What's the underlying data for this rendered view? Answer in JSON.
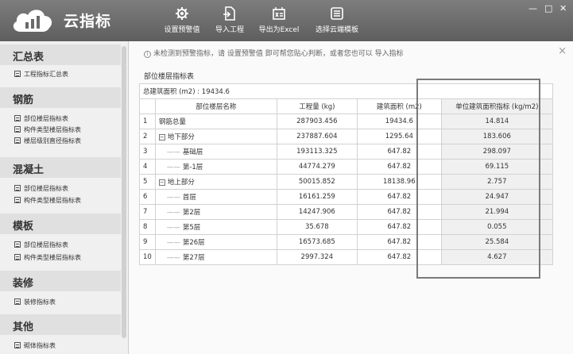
{
  "app": {
    "title": "云指标"
  },
  "toolbar": [
    {
      "label": "设置预警值",
      "icon": "gear-icon"
    },
    {
      "label": "导入工程",
      "icon": "import-icon"
    },
    {
      "label": "导出为Excel",
      "icon": "excel-icon"
    },
    {
      "label": "选择云端模板",
      "icon": "template-icon"
    }
  ],
  "sidebar": {
    "sections": [
      {
        "title": "汇总表",
        "items": [
          "工程指标汇总表"
        ]
      },
      {
        "title": "钢筋",
        "items": [
          "部位楼层指标表",
          "构件类型楼层指标表",
          "楼层级别直径指标表"
        ]
      },
      {
        "title": "混凝土",
        "items": [
          "部位楼层指标表",
          "构件类型楼层指标表"
        ]
      },
      {
        "title": "模板",
        "items": [
          "部位楼层指标表",
          "构件类型楼层指标表"
        ]
      },
      {
        "title": "装修",
        "items": [
          "装修指标表"
        ]
      },
      {
        "title": "其他",
        "items": [
          "砌体指标表"
        ]
      }
    ]
  },
  "main": {
    "notice": "未检测到预警指标，请 设置预警值 即可帮您贴心判断，或者您也可以 导入指标",
    "section_title": "部位楼层指标表",
    "total_area": "总建筑面积 (m2) : 19434.6",
    "columns": [
      "部位楼层名称",
      "工程量 (kg)",
      "建筑面积 (m2)",
      "单位建筑面积指标 (kg/m2)"
    ],
    "rows": [
      {
        "idx": "1",
        "name": "钢筋总量",
        "level": 0,
        "toggle": false,
        "qty": "287903.456",
        "area": "19434.6",
        "unit": "14.814"
      },
      {
        "idx": "2",
        "name": "地下部分",
        "level": 0,
        "toggle": true,
        "qty": "237887.604",
        "area": "1295.64",
        "unit": "183.606"
      },
      {
        "idx": "3",
        "name": "基础层",
        "level": 1,
        "toggle": false,
        "qty": "193113.325",
        "area": "647.82",
        "unit": "298.097"
      },
      {
        "idx": "4",
        "name": "第-1层",
        "level": 1,
        "toggle": false,
        "qty": "44774.279",
        "area": "647.82",
        "unit": "69.115"
      },
      {
        "idx": "5",
        "name": "地上部分",
        "level": 0,
        "toggle": true,
        "qty": "50015.852",
        "area": "18138.96",
        "unit": "2.757"
      },
      {
        "idx": "6",
        "name": "首层",
        "level": 1,
        "toggle": false,
        "qty": "16161.259",
        "area": "647.82",
        "unit": "24.947"
      },
      {
        "idx": "7",
        "name": "第2层",
        "level": 1,
        "toggle": false,
        "qty": "14247.906",
        "area": "647.82",
        "unit": "21.994"
      },
      {
        "idx": "8",
        "name": "第5层",
        "level": 1,
        "toggle": false,
        "qty": "35.678",
        "area": "647.82",
        "unit": "0.055"
      },
      {
        "idx": "9",
        "name": "第26层",
        "level": 1,
        "toggle": false,
        "qty": "16573.685",
        "area": "647.82",
        "unit": "25.584"
      },
      {
        "idx": "10",
        "name": "第27层",
        "level": 1,
        "toggle": false,
        "qty": "2997.324",
        "area": "647.82",
        "unit": "4.627"
      }
    ]
  }
}
